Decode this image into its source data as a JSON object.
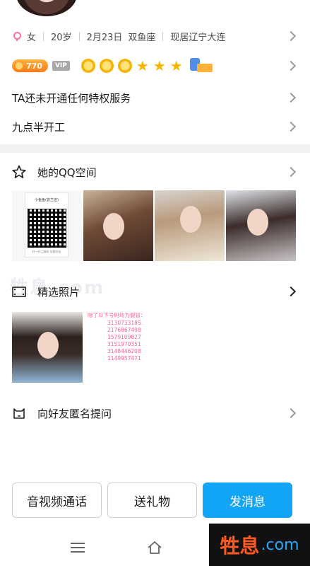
{
  "profile": {
    "info": [
      "女",
      "20岁",
      "2月23日",
      "双鱼座",
      "现居辽宁大连"
    ],
    "coin_value": "770",
    "vip_label": "VIP",
    "privilege_text": "TA还未开通任何特权服务",
    "status_text": "九点半开工"
  },
  "qq_space": {
    "title": "她的QQ空间",
    "qr_name": "小鱼鱼(曾兰店)",
    "qr_note": "扫一扫二维码 加我好友"
  },
  "picked_photos": {
    "title": "精选照片",
    "note_head": "除了以下号码均为假冒：",
    "numbers": [
      "3130733185",
      "2176867498",
      "1579109827",
      "3151970351",
      "3148446208",
      "1149957471"
    ]
  },
  "anonymous_ask": {
    "label": "向好友匿名提问"
  },
  "actions": {
    "call": "音视频通话",
    "gift": "送礼物",
    "message": "发消息"
  },
  "watermark": {
    "zh": "牲息",
    "dom": ".com"
  },
  "colors": {
    "primary": "#12a5f6",
    "female": "#ff6fa0",
    "note_pink": "#ff5f8f"
  }
}
